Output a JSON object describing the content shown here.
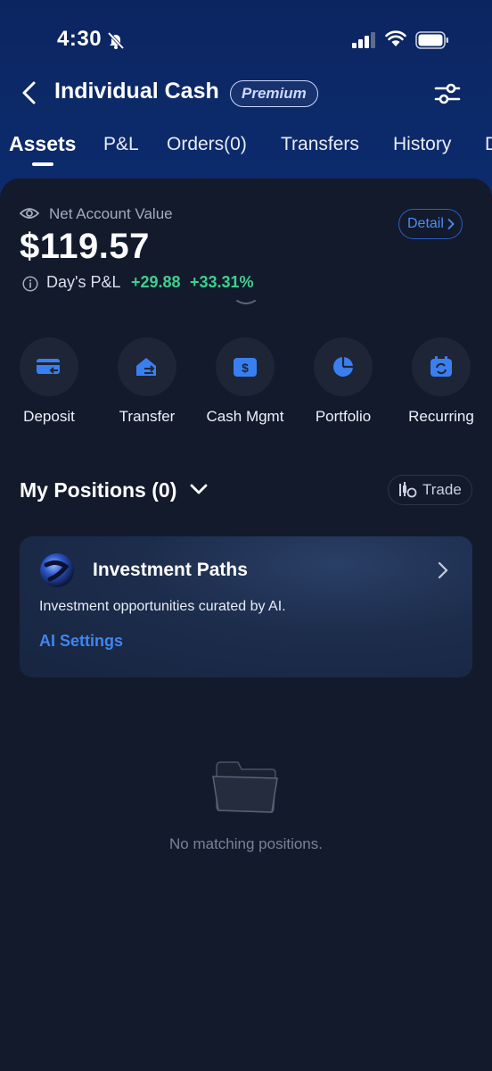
{
  "status_bar": {
    "time": "4:30"
  },
  "header": {
    "title": "Individual Cash",
    "badge": "Premium",
    "icons": {
      "back": "chevron-left-icon",
      "settings": "sliders-icon"
    }
  },
  "tabs": [
    {
      "label": "Assets",
      "active": true
    },
    {
      "label": "P&L"
    },
    {
      "label": "Orders(0)"
    },
    {
      "label": "Transfers"
    },
    {
      "label": "History"
    },
    {
      "label": "D"
    }
  ],
  "account": {
    "label": "Net Account Value",
    "value": "$119.57",
    "detail_label": "Detail",
    "day_pl_label": "Day's P&L",
    "day_pl_amount": "+29.88",
    "day_pl_percent": "+33.31%"
  },
  "actions": [
    {
      "label": "Deposit",
      "icon": "deposit-card-icon"
    },
    {
      "label": "Transfer",
      "icon": "transfer-house-icon"
    },
    {
      "label": "Cash Mgmt",
      "icon": "cash-wallet-icon"
    },
    {
      "label": "Portfolio",
      "icon": "pie-chart-icon"
    },
    {
      "label": "Recurring",
      "icon": "recurring-calendar-icon"
    }
  ],
  "positions": {
    "title": "My Positions (0)",
    "trade_label": "Trade"
  },
  "investment_card": {
    "title": "Investment Paths",
    "description": "Investment opportunities curated by AI.",
    "link": "AI Settings"
  },
  "empty_state": {
    "text": "No matching positions."
  },
  "colors": {
    "header_bg": "#0c2a6a",
    "sheet_bg": "#121a2c",
    "accent": "#3f86f2",
    "gain": "#3fcf8f"
  }
}
